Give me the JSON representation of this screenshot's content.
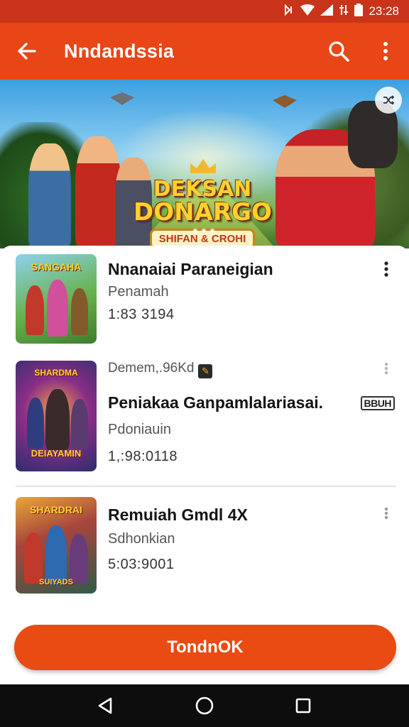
{
  "status_bar": {
    "time": "23:28",
    "icons": [
      "nfc-icon",
      "wifi-icon",
      "signal-icon",
      "data-icon",
      "battery-icon"
    ]
  },
  "app_bar": {
    "title": "Nndandssia",
    "back_icon": "arrow-left-icon",
    "search_icon": "search-icon",
    "menu_icon": "more-vertical-icon"
  },
  "banner": {
    "logo_line1": "DEKSAN",
    "logo_line2": "DONARGO",
    "logo_plate": "SHIFAN & CROHI",
    "corner_icon": "shuffle-icon",
    "page_count": 3
  },
  "list": {
    "items": [
      {
        "name": "Nnanaiai Paraneigian",
        "sub": "Penamah",
        "meta": "1:83 3194",
        "thumb_title": "SANGAHA",
        "thumb_footer": ""
      },
      {
        "top_label": "Demem,.96Kd",
        "name": "Peniakaa Ganpamlalariasai.",
        "sub": "Pdoniauin",
        "meta": "1,:98:0118",
        "tag": "BBUH",
        "thumb_title": "SHARDMA",
        "thumb_footer": "DEIAYAMIN"
      },
      {
        "name": "Remuiah Gmdl 4X",
        "sub": "Sdhonkian",
        "meta": "5:03:9001",
        "thumb_title": "SHARDRAI",
        "thumb_footer": "SUIYADS"
      }
    ]
  },
  "cta": {
    "label": "TondnOK"
  },
  "colors": {
    "primary": "#e84617",
    "status_bar": "#c9341a",
    "cta": "#ea4b12",
    "nav_bar": "#0d0d0d"
  }
}
